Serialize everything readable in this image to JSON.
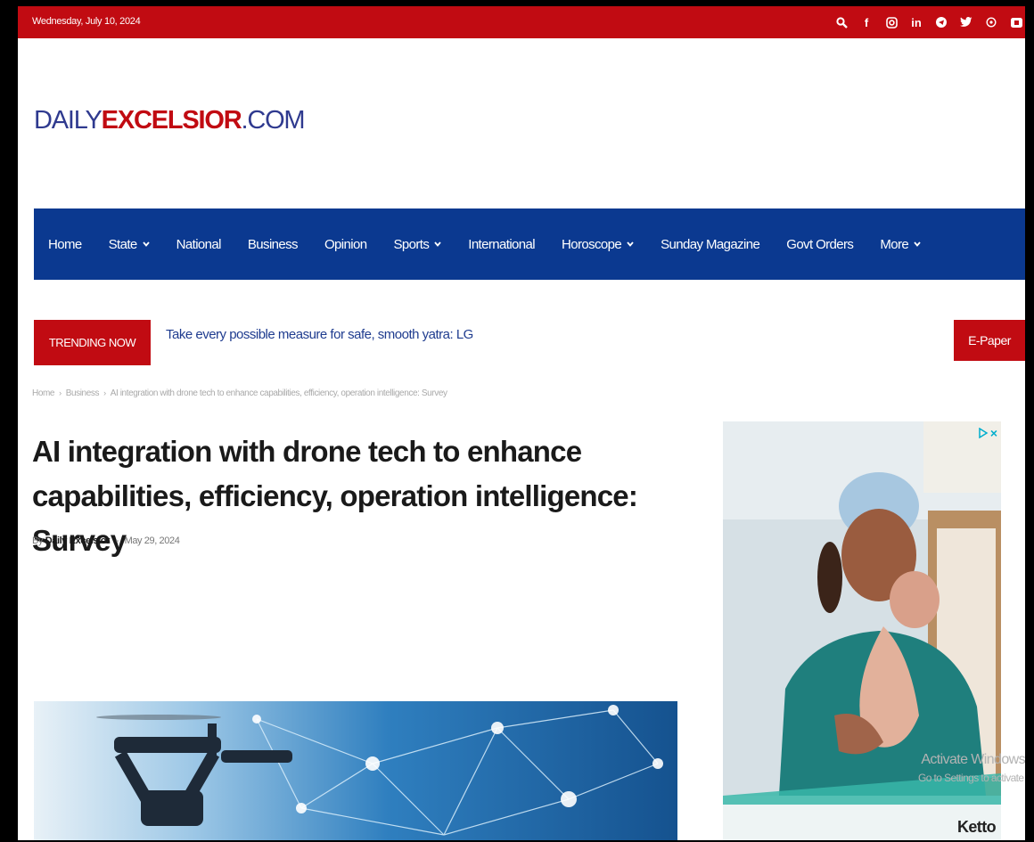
{
  "top_bar": {
    "date": "Wednesday, July 10, 2024",
    "icons": [
      "search-icon",
      "facebook-icon",
      "instagram-icon",
      "linkedin-icon",
      "telegram-icon",
      "twitter-icon",
      "whatsapp-icon",
      "youtube-icon"
    ]
  },
  "logo": {
    "prefix": "DAILY",
    "middle": "EXCELSIOR",
    "suffix": ".COM"
  },
  "nav": {
    "items": [
      {
        "label": "Home",
        "has_dropdown": false
      },
      {
        "label": "State",
        "has_dropdown": true
      },
      {
        "label": "National",
        "has_dropdown": false
      },
      {
        "label": "Business",
        "has_dropdown": false
      },
      {
        "label": "Opinion",
        "has_dropdown": false
      },
      {
        "label": "Sports",
        "has_dropdown": true
      },
      {
        "label": "International",
        "has_dropdown": false
      },
      {
        "label": "Horoscope",
        "has_dropdown": true
      },
      {
        "label": "Sunday Magazine",
        "has_dropdown": false
      },
      {
        "label": "Govt Orders",
        "has_dropdown": false
      },
      {
        "label": "More",
        "has_dropdown": true
      }
    ]
  },
  "trending": {
    "badge": "TRENDING NOW",
    "headline": "Take every possible measure for safe, smooth yatra: LG",
    "epaper": "E-Paper"
  },
  "breadcrumb": {
    "items": [
      "Home",
      "Business",
      "AI integration with drone tech to enhance capabilities, efficiency, operation intelligence: Survey"
    ]
  },
  "article": {
    "title": "AI integration with drone tech to enhance capabilities, efficiency, operation intelligence: Survey",
    "by": "By",
    "author": "Daily Excelsior",
    "dash": "-",
    "date": "May 29, 2024"
  },
  "ad": {
    "brand": "Ketto"
  },
  "watermark": {
    "line1": "Activate Windows",
    "line2": "Go to Settings to activate Windows."
  },
  "colors": {
    "brand_red": "#c10b12",
    "nav_blue": "#0b3990",
    "logo_blue": "#2f3a8f"
  }
}
